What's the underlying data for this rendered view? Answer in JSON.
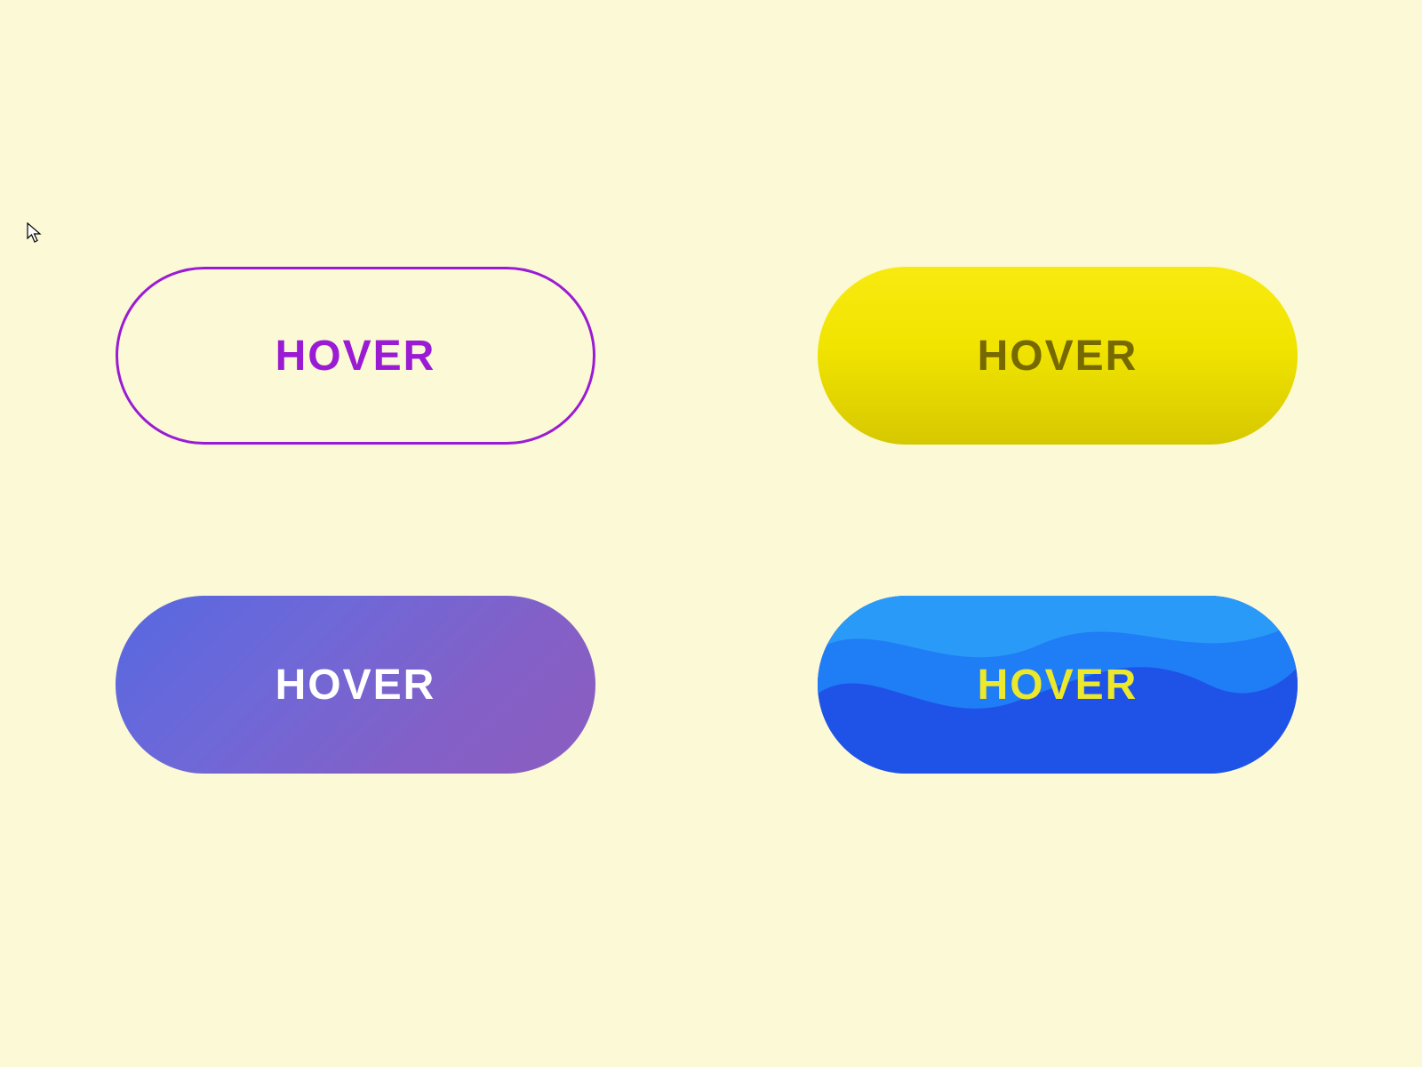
{
  "buttons": {
    "b1": {
      "label": "HOVER"
    },
    "b2": {
      "label": "HOVER"
    },
    "b3": {
      "label": "HOVER"
    },
    "b4": {
      "label": "HOVER"
    }
  },
  "colors": {
    "page_bg": "#fbf9d6",
    "purple_accent": "#9b1bd4",
    "yellow_top": "#f8ea10",
    "yellow_bottom": "#d6c800",
    "yellow_text": "#756900",
    "grad_blue": "#5768e0",
    "grad_purple": "#8c5dc0",
    "wave_base": "#1f53e7",
    "wave_mid": "#1f7df6",
    "wave_top": "#2a9af8",
    "lime_text": "#ece82c",
    "white": "#ffffff"
  }
}
